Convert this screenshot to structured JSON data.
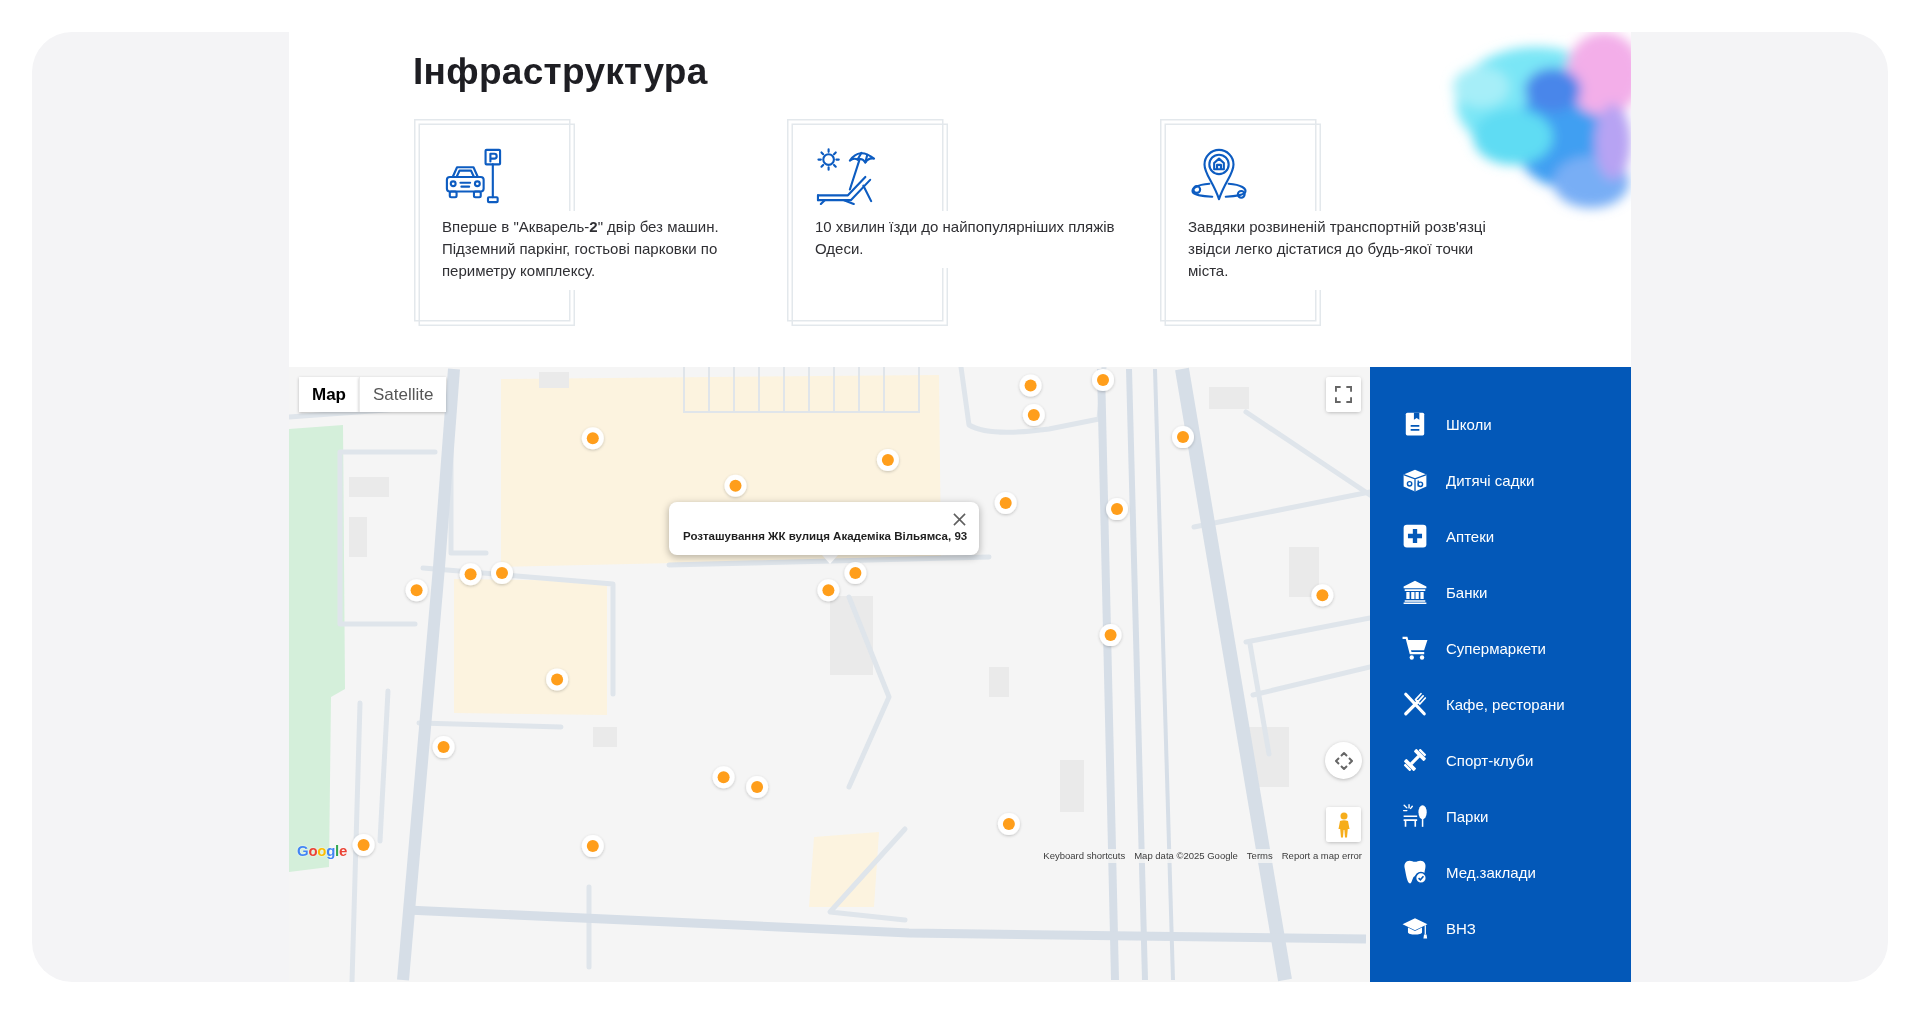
{
  "heading": "Інфраструктура",
  "features": [
    {
      "kind": "parking",
      "text": "Вперше в \"Акварель-**2**\" двір без машин. Підземний паркінг, гостьові парковки по периметру комплексу."
    },
    {
      "kind": "beach",
      "text": "10 хвилин їзди до найпопулярніших пляжів Одеси."
    },
    {
      "kind": "transport",
      "text": "Завдяки розвиненій транспортній розв'язці звідси легко дістатися до будь-якої точки міста."
    }
  ],
  "map": {
    "map_types": [
      {
        "label": "Map",
        "selected": true
      },
      {
        "label": "Satellite",
        "selected": false
      }
    ],
    "info_window": {
      "text": "Розташування ЖК вулиця Академіка Вільямса, 93"
    },
    "logo": "Google",
    "attribution": [
      "Keyboard shortcuts",
      "Map data ©2025 Google",
      "Terms",
      "Report a map error"
    ]
  },
  "categories": [
    {
      "kind": "school",
      "label": "Школи"
    },
    {
      "kind": "kindergarten",
      "label": "Дитячі садки"
    },
    {
      "kind": "pharmacy",
      "label": "Аптеки"
    },
    {
      "kind": "bank",
      "label": "Банки"
    },
    {
      "kind": "supermarket",
      "label": "Супермаркети"
    },
    {
      "kind": "cafe",
      "label": "Кафе, ресторани"
    },
    {
      "kind": "sport",
      "label": "Спорт-клуби"
    },
    {
      "kind": "park",
      "label": "Парки"
    },
    {
      "kind": "medical",
      "label": "Мед.заклади"
    },
    {
      "kind": "university",
      "label": "ВНЗ"
    }
  ]
}
